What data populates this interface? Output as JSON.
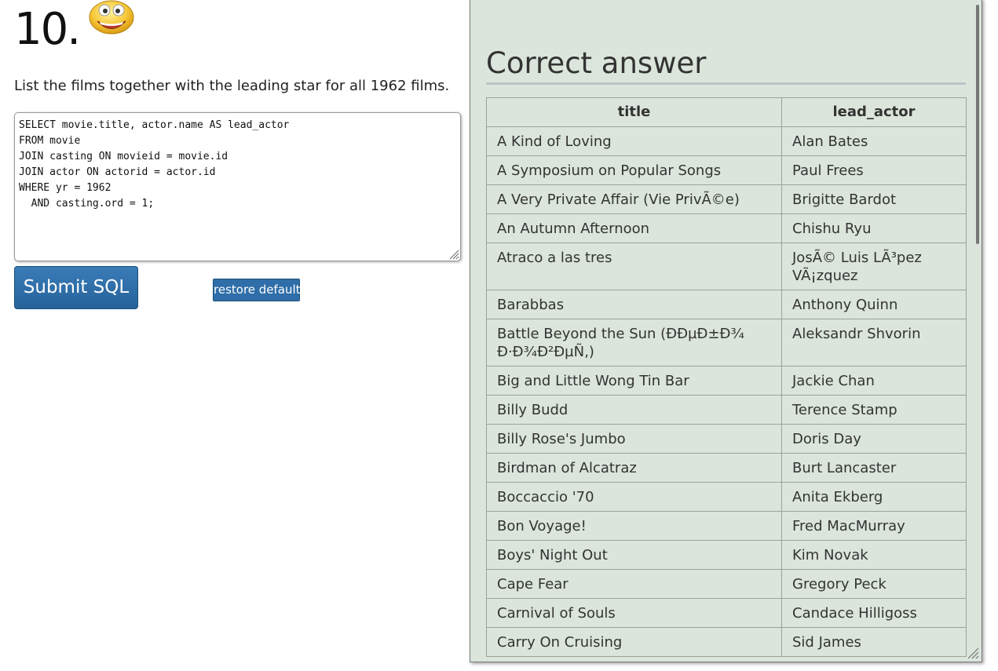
{
  "question": {
    "number": "10.",
    "text": "List the films together with the leading star for all 1962 films."
  },
  "sql_editor": {
    "value": "SELECT movie.title, actor.name AS lead_actor\nFROM movie\nJOIN casting ON movieid = movie.id\nJOIN actor ON actorid = actor.id\nWHERE yr = 1962\n  AND casting.ord = 1;"
  },
  "buttons": {
    "submit_label": "Submit SQL",
    "restore_label": "restore default"
  },
  "answer": {
    "heading": "Correct answer",
    "columns": [
      "title",
      "lead_actor"
    ],
    "rows": [
      {
        "title": [
          "A Kind of Loving"
        ],
        "lead_actor": [
          "Alan Bates"
        ]
      },
      {
        "title": [
          "A Symposium on Popular Songs"
        ],
        "lead_actor": [
          "Paul Frees"
        ]
      },
      {
        "title": [
          "A Very Private Affair (Vie PrivÃ©e)"
        ],
        "lead_actor": [
          "Brigitte Bardot"
        ]
      },
      {
        "title": [
          "An Autumn Afternoon"
        ],
        "lead_actor": [
          "Chishu Ryu"
        ]
      },
      {
        "title": [
          "Atraco a las tres"
        ],
        "lead_actor": [
          "JosÃ© Luis LÃ³pez",
          "VÃ¡zquez"
        ]
      },
      {
        "title": [
          "Barabbas"
        ],
        "lead_actor": [
          "Anthony Quinn"
        ]
      },
      {
        "title": [
          "Battle Beyond the Sun (ÐÐµÐ±Ð¾",
          "Ð·Ð¾Ð²ÐµÑ‚)"
        ],
        "lead_actor": [
          "Aleksandr Shvorin"
        ]
      },
      {
        "title": [
          "Big and Little Wong Tin Bar"
        ],
        "lead_actor": [
          "Jackie Chan"
        ]
      },
      {
        "title": [
          "Billy Budd"
        ],
        "lead_actor": [
          "Terence Stamp"
        ]
      },
      {
        "title": [
          "Billy Rose's Jumbo"
        ],
        "lead_actor": [
          "Doris Day"
        ]
      },
      {
        "title": [
          "Birdman of Alcatraz"
        ],
        "lead_actor": [
          "Burt Lancaster"
        ]
      },
      {
        "title": [
          "Boccaccio '70"
        ],
        "lead_actor": [
          "Anita Ekberg"
        ]
      },
      {
        "title": [
          "Bon Voyage!"
        ],
        "lead_actor": [
          "Fred MacMurray"
        ]
      },
      {
        "title": [
          "Boys' Night Out"
        ],
        "lead_actor": [
          "Kim Novak"
        ]
      },
      {
        "title": [
          "Cape Fear"
        ],
        "lead_actor": [
          "Gregory Peck"
        ]
      },
      {
        "title": [
          "Carnival of Souls"
        ],
        "lead_actor": [
          "Candace Hilligoss"
        ]
      },
      {
        "title": [
          "Carry On Cruising"
        ],
        "lead_actor": [
          "Sid James"
        ]
      }
    ]
  },
  "icons": {
    "smiley": "smiley-face-icon",
    "resize": "resize-grip-icon"
  },
  "colors": {
    "panel_bg": "#dbe5db",
    "button_blue": "#2f6ea8"
  }
}
